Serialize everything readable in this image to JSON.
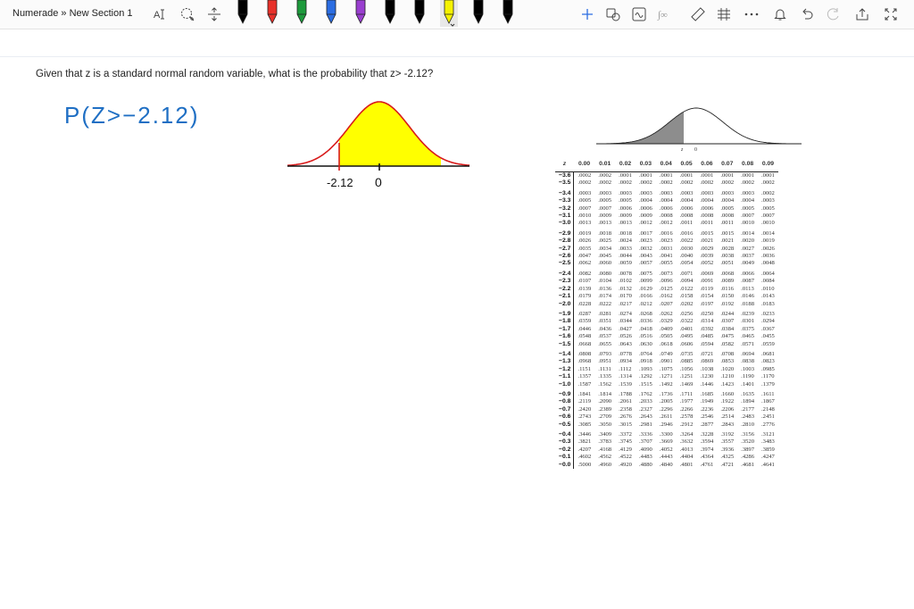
{
  "app": {
    "breadcrumb": "Numerade » New Section 1"
  },
  "toolbar": {
    "pens": [
      {
        "name": "pen-black",
        "color": "#000000"
      },
      {
        "name": "pen-red",
        "color": "#e8312a"
      },
      {
        "name": "pen-green",
        "color": "#1d9a3c"
      },
      {
        "name": "pen-blue",
        "color": "#2b6de2"
      },
      {
        "name": "pen-purple",
        "color": "#9a3fd0"
      },
      {
        "name": "pen-black-2",
        "color": "#000000"
      },
      {
        "name": "pen-black-3",
        "color": "#000000"
      },
      {
        "name": "highlighter-yellow",
        "color": "#f5f200"
      },
      {
        "name": "pen-black-4",
        "color": "#000000"
      },
      {
        "name": "pen-black-5",
        "color": "#000000"
      }
    ],
    "accent": "#2b6de2"
  },
  "question": {
    "text": "Given that z is a standard normal random variable, what is the probability that z> -2.12?"
  },
  "handwriting": {
    "expression": "P(Z>−2.12)",
    "label_left": "-2.12",
    "label_zero": "0",
    "ink_color": "#1f6fc4",
    "fill_color": "#ffff00",
    "mark_color": "#d81b1b"
  },
  "ztable": {
    "figure_labels": {
      "z": "z",
      "zero": "0"
    },
    "headers": [
      "z",
      "0.00",
      "0.01",
      "0.02",
      "0.03",
      "0.04",
      "0.05",
      "0.06",
      "0.07",
      "0.08",
      "0.09"
    ],
    "groups": [
      [
        [
          "−3.6",
          ".0002",
          ".0002",
          ".0001",
          ".0001",
          ".0001",
          ".0001",
          ".0001",
          ".0001",
          ".0001",
          ".0001"
        ],
        [
          "−3.5",
          ".0002",
          ".0002",
          ".0002",
          ".0002",
          ".0002",
          ".0002",
          ".0002",
          ".0002",
          ".0002",
          ".0002"
        ]
      ],
      [
        [
          "−3.4",
          ".0003",
          ".0003",
          ".0003",
          ".0003",
          ".0003",
          ".0003",
          ".0003",
          ".0003",
          ".0003",
          ".0002"
        ],
        [
          "−3.3",
          ".0005",
          ".0005",
          ".0005",
          ".0004",
          ".0004",
          ".0004",
          ".0004",
          ".0004",
          ".0004",
          ".0003"
        ],
        [
          "−3.2",
          ".0007",
          ".0007",
          ".0006",
          ".0006",
          ".0006",
          ".0006",
          ".0006",
          ".0005",
          ".0005",
          ".0005"
        ],
        [
          "−3.1",
          ".0010",
          ".0009",
          ".0009",
          ".0009",
          ".0008",
          ".0008",
          ".0008",
          ".0008",
          ".0007",
          ".0007"
        ],
        [
          "−3.0",
          ".0013",
          ".0013",
          ".0013",
          ".0012",
          ".0012",
          ".0011",
          ".0011",
          ".0011",
          ".0010",
          ".0010"
        ]
      ],
      [
        [
          "−2.9",
          ".0019",
          ".0018",
          ".0018",
          ".0017",
          ".0016",
          ".0016",
          ".0015",
          ".0015",
          ".0014",
          ".0014"
        ],
        [
          "−2.8",
          ".0026",
          ".0025",
          ".0024",
          ".0023",
          ".0023",
          ".0022",
          ".0021",
          ".0021",
          ".0020",
          ".0019"
        ],
        [
          "−2.7",
          ".0035",
          ".0034",
          ".0033",
          ".0032",
          ".0031",
          ".0030",
          ".0029",
          ".0028",
          ".0027",
          ".0026"
        ],
        [
          "−2.6",
          ".0047",
          ".0045",
          ".0044",
          ".0043",
          ".0041",
          ".0040",
          ".0039",
          ".0038",
          ".0037",
          ".0036"
        ],
        [
          "−2.5",
          ".0062",
          ".0060",
          ".0059",
          ".0057",
          ".0055",
          ".0054",
          ".0052",
          ".0051",
          ".0049",
          ".0048"
        ]
      ],
      [
        [
          "−2.4",
          ".0082",
          ".0080",
          ".0078",
          ".0075",
          ".0073",
          ".0071",
          ".0069",
          ".0068",
          ".0066",
          ".0064"
        ],
        [
          "−2.3",
          ".0107",
          ".0104",
          ".0102",
          ".0099",
          ".0096",
          ".0094",
          ".0091",
          ".0089",
          ".0087",
          ".0084"
        ],
        [
          "−2.2",
          ".0139",
          ".0136",
          ".0132",
          ".0129",
          ".0125",
          ".0122",
          ".0119",
          ".0116",
          ".0113",
          ".0110"
        ],
        [
          "−2.1",
          ".0179",
          ".0174",
          ".0170",
          ".0166",
          ".0162",
          ".0158",
          ".0154",
          ".0150",
          ".0146",
          ".0143"
        ],
        [
          "−2.0",
          ".0228",
          ".0222",
          ".0217",
          ".0212",
          ".0207",
          ".0202",
          ".0197",
          ".0192",
          ".0188",
          ".0183"
        ]
      ],
      [
        [
          "−1.9",
          ".0287",
          ".0281",
          ".0274",
          ".0268",
          ".0262",
          ".0256",
          ".0250",
          ".0244",
          ".0239",
          ".0233"
        ],
        [
          "−1.8",
          ".0359",
          ".0351",
          ".0344",
          ".0336",
          ".0329",
          ".0322",
          ".0314",
          ".0307",
          ".0301",
          ".0294"
        ],
        [
          "−1.7",
          ".0446",
          ".0436",
          ".0427",
          ".0418",
          ".0409",
          ".0401",
          ".0392",
          ".0384",
          ".0375",
          ".0367"
        ],
        [
          "−1.6",
          ".0548",
          ".0537",
          ".0526",
          ".0516",
          ".0505",
          ".0495",
          ".0485",
          ".0475",
          ".0465",
          ".0455"
        ],
        [
          "−1.5",
          ".0668",
          ".0655",
          ".0643",
          ".0630",
          ".0618",
          ".0606",
          ".0594",
          ".0582",
          ".0571",
          ".0559"
        ]
      ],
      [
        [
          "−1.4",
          ".0808",
          ".0793",
          ".0778",
          ".0764",
          ".0749",
          ".0735",
          ".0721",
          ".0708",
          ".0694",
          ".0681"
        ],
        [
          "−1.3",
          ".0968",
          ".0951",
          ".0934",
          ".0918",
          ".0901",
          ".0885",
          ".0869",
          ".0853",
          ".0838",
          ".0823"
        ],
        [
          "−1.2",
          ".1151",
          ".1131",
          ".1112",
          ".1093",
          ".1075",
          ".1056",
          ".1038",
          ".1020",
          ".1003",
          ".0985"
        ],
        [
          "−1.1",
          ".1357",
          ".1335",
          ".1314",
          ".1292",
          ".1271",
          ".1251",
          ".1230",
          ".1210",
          ".1190",
          ".1170"
        ],
        [
          "−1.0",
          ".1587",
          ".1562",
          ".1539",
          ".1515",
          ".1492",
          ".1469",
          ".1446",
          ".1423",
          ".1401",
          ".1379"
        ]
      ],
      [
        [
          "−0.9",
          ".1841",
          ".1814",
          ".1788",
          ".1762",
          ".1736",
          ".1711",
          ".1685",
          ".1660",
          ".1635",
          ".1611"
        ],
        [
          "−0.8",
          ".2119",
          ".2090",
          ".2061",
          ".2033",
          ".2005",
          ".1977",
          ".1949",
          ".1922",
          ".1894",
          ".1867"
        ],
        [
          "−0.7",
          ".2420",
          ".2389",
          ".2358",
          ".2327",
          ".2296",
          ".2266",
          ".2236",
          ".2206",
          ".2177",
          ".2148"
        ],
        [
          "−0.6",
          ".2743",
          ".2709",
          ".2676",
          ".2643",
          ".2611",
          ".2578",
          ".2546",
          ".2514",
          ".2483",
          ".2451"
        ],
        [
          "−0.5",
          ".3085",
          ".3050",
          ".3015",
          ".2981",
          ".2946",
          ".2912",
          ".2877",
          ".2843",
          ".2810",
          ".2776"
        ]
      ],
      [
        [
          "−0.4",
          ".3446",
          ".3409",
          ".3372",
          ".3336",
          ".3300",
          ".3264",
          ".3228",
          ".3192",
          ".3156",
          ".3121"
        ],
        [
          "−0.3",
          ".3821",
          ".3783",
          ".3745",
          ".3707",
          ".3669",
          ".3632",
          ".3594",
          ".3557",
          ".3520",
          ".3483"
        ],
        [
          "−0.2",
          ".4207",
          ".4168",
          ".4129",
          ".4090",
          ".4052",
          ".4013",
          ".3974",
          ".3936",
          ".3897",
          ".3859"
        ],
        [
          "−0.1",
          ".4602",
          ".4562",
          ".4522",
          ".4483",
          ".4443",
          ".4404",
          ".4364",
          ".4325",
          ".4286",
          ".4247"
        ],
        [
          "−0.0",
          ".5000",
          ".4960",
          ".4920",
          ".4880",
          ".4840",
          ".4801",
          ".4761",
          ".4721",
          ".4681",
          ".4641"
        ]
      ]
    ]
  }
}
